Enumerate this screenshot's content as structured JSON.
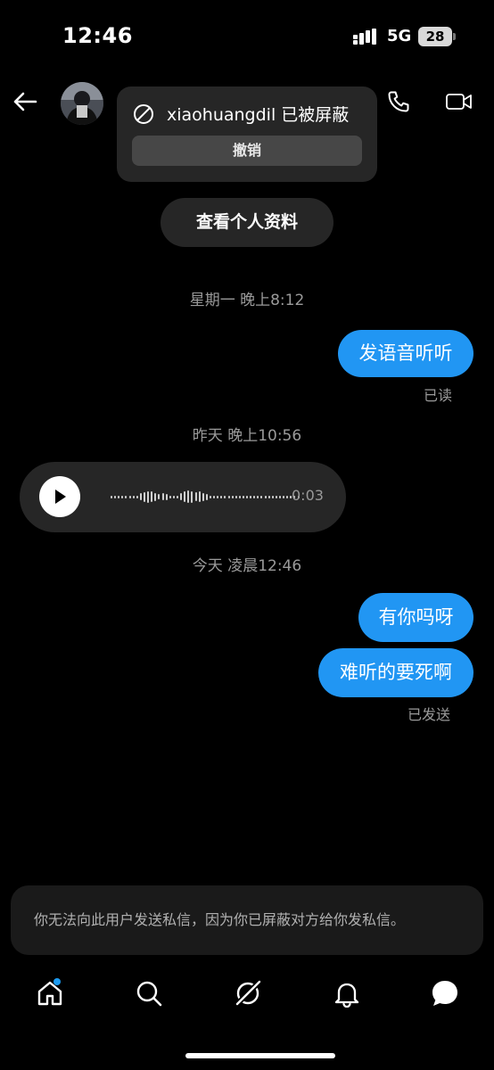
{
  "status_bar": {
    "time": "12:46",
    "network": "5G",
    "battery": "28"
  },
  "header": {
    "back_icon": "arrow-left-icon",
    "call_icon": "phone-icon",
    "video_icon": "video-camera-icon"
  },
  "blocked_popup": {
    "message": "xiaohuangdil 已被屏蔽",
    "undo_label": "撤销",
    "icon": "block-icon"
  },
  "profile_button": {
    "label": "查看个人资料"
  },
  "conversation": {
    "timestamp_1": "星期一 晚上8:12",
    "message_1": "发语音听听",
    "receipt_1": "已读",
    "timestamp_2": "昨天 晚上10:56",
    "voice_message": {
      "duration": "0:03",
      "progress": 0
    },
    "timestamp_3": "今天 凌晨12:46",
    "message_2": "有你吗呀",
    "message_3": "难听的要死啊",
    "receipt_3": "已发送"
  },
  "notice": {
    "text": "你无法向此用户发送私信，因为你已屏蔽对方给你发私信。"
  },
  "tab_bar": {
    "items": [
      "home-icon",
      "search-icon",
      "grok-icon",
      "notifications-bell-icon",
      "messages-icon"
    ],
    "active": "messages-icon",
    "badge_color": "#1d9bf0"
  },
  "colors": {
    "accent": "#2196f3",
    "background": "#000000",
    "surface": "#262626"
  }
}
